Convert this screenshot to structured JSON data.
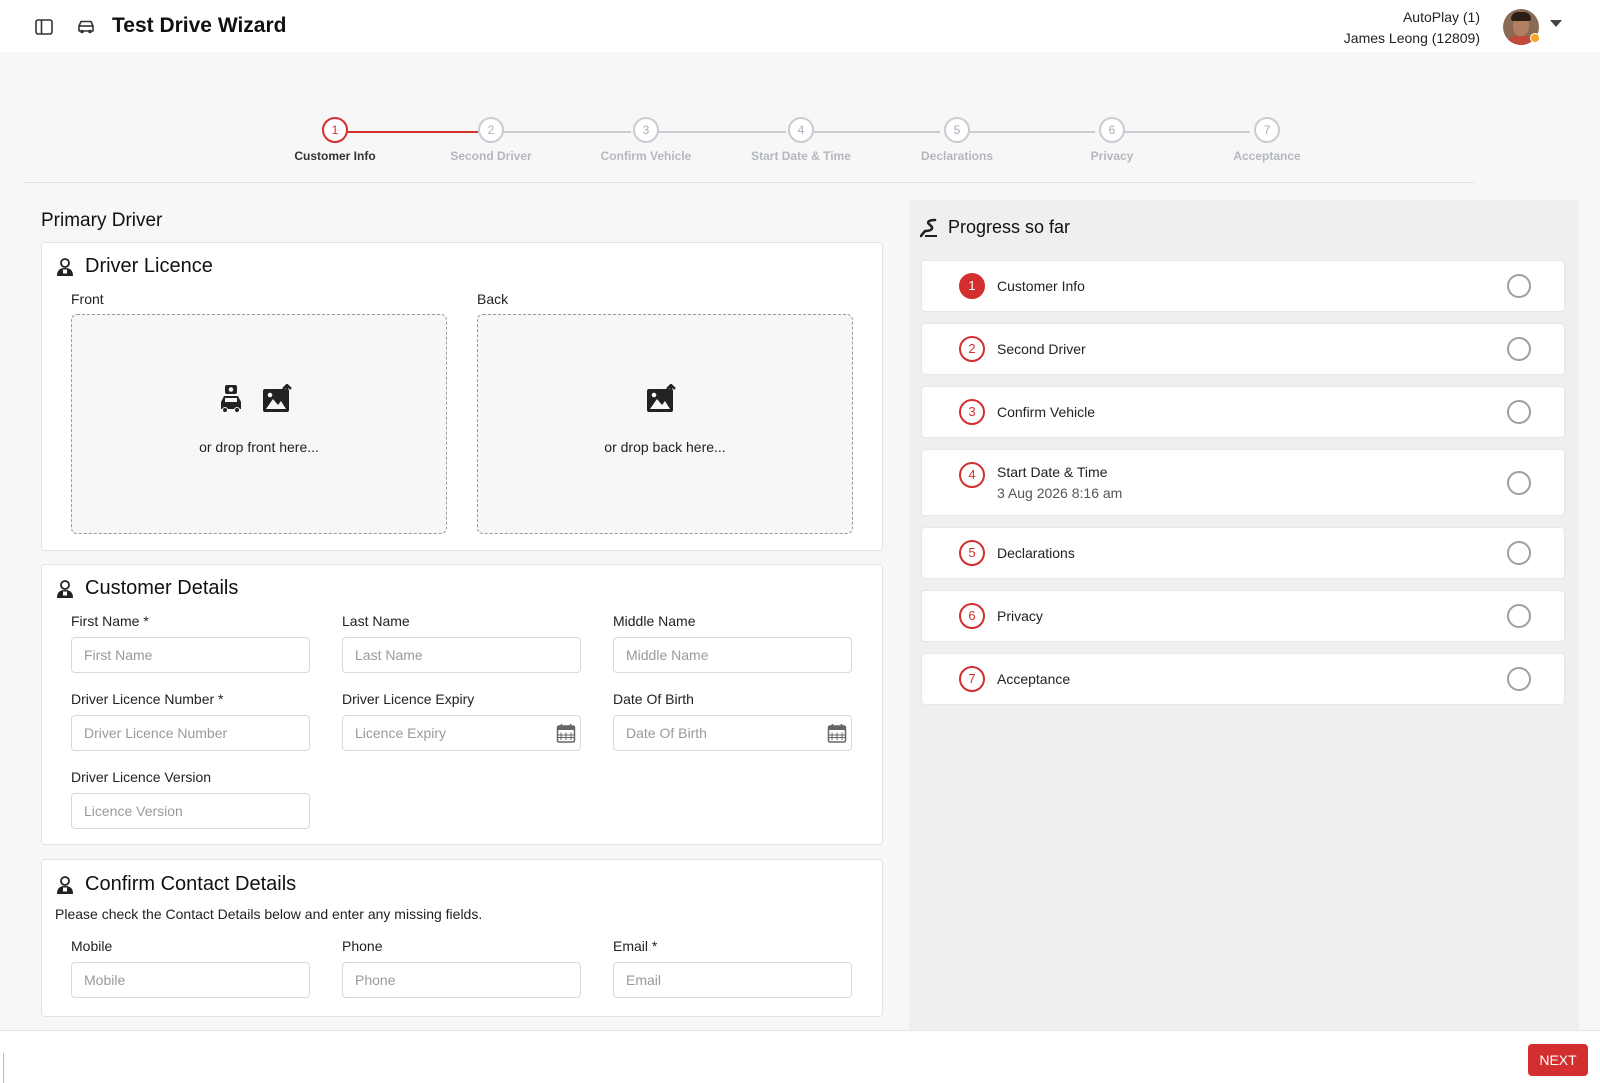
{
  "header": {
    "title": "Test Drive Wizard",
    "account_line1": "AutoPlay (1)",
    "account_line2": "James Leong (12809)",
    "icons": [
      "sidebar-toggle-icon",
      "car-icon",
      "avatar",
      "chevron-down-icon"
    ],
    "status_color": "#f5a623"
  },
  "stepper": {
    "current_step": 1,
    "steps": [
      {
        "number": "1",
        "label": "Customer Info"
      },
      {
        "number": "2",
        "label": "Second Driver"
      },
      {
        "number": "3",
        "label": "Confirm Vehicle"
      },
      {
        "number": "4",
        "label": "Start Date & Time"
      },
      {
        "number": "5",
        "label": "Declarations"
      },
      {
        "number": "6",
        "label": "Privacy"
      },
      {
        "number": "7",
        "label": "Acceptance"
      }
    ]
  },
  "main": {
    "section_heading": "Primary Driver",
    "licence": {
      "title": "Driver Licence",
      "front_label": "Front",
      "back_label": "Back",
      "front_drop_text": "or drop front here...",
      "back_drop_text": "or drop back here..."
    },
    "customer_details": {
      "title": "Customer Details",
      "first_name": {
        "label": "First Name *",
        "placeholder": "First Name",
        "value": ""
      },
      "last_name": {
        "label": "Last Name",
        "placeholder": "Last Name",
        "value": ""
      },
      "middle_name": {
        "label": "Middle Name",
        "placeholder": "Middle Name",
        "value": ""
      },
      "licence_number": {
        "label": "Driver Licence Number *",
        "placeholder": "Driver Licence Number",
        "value": ""
      },
      "licence_expiry": {
        "label": "Driver Licence Expiry",
        "placeholder": "Licence Expiry",
        "value": ""
      },
      "dob": {
        "label": "Date Of Birth",
        "placeholder": "Date Of Birth",
        "value": ""
      },
      "licence_version": {
        "label": "Driver Licence Version",
        "placeholder": "Licence Version",
        "value": ""
      }
    },
    "contact": {
      "title": "Confirm Contact Details",
      "note": "Please check the Contact Details below and enter any missing fields.",
      "mobile": {
        "label": "Mobile",
        "placeholder": "Mobile",
        "value": ""
      },
      "phone": {
        "label": "Phone",
        "placeholder": "Phone",
        "value": ""
      },
      "email": {
        "label": "Email *",
        "placeholder": "Email",
        "value": ""
      }
    }
  },
  "progress": {
    "title": "Progress so far",
    "items": [
      {
        "number": "1",
        "label": "Customer Info",
        "sub": ""
      },
      {
        "number": "2",
        "label": "Second Driver",
        "sub": ""
      },
      {
        "number": "3",
        "label": "Confirm Vehicle",
        "sub": ""
      },
      {
        "number": "4",
        "label": "Start Date & Time",
        "sub": "3 Aug 2026 8:16 am"
      },
      {
        "number": "5",
        "label": "Declarations",
        "sub": ""
      },
      {
        "number": "6",
        "label": "Privacy",
        "sub": ""
      },
      {
        "number": "7",
        "label": "Acceptance",
        "sub": ""
      }
    ]
  },
  "footer": {
    "next_label": "NEXT"
  },
  "colors": {
    "accent": "#d32f2f",
    "step_inactive": "#c8ccd3",
    "panel_bg": "#efefef"
  }
}
